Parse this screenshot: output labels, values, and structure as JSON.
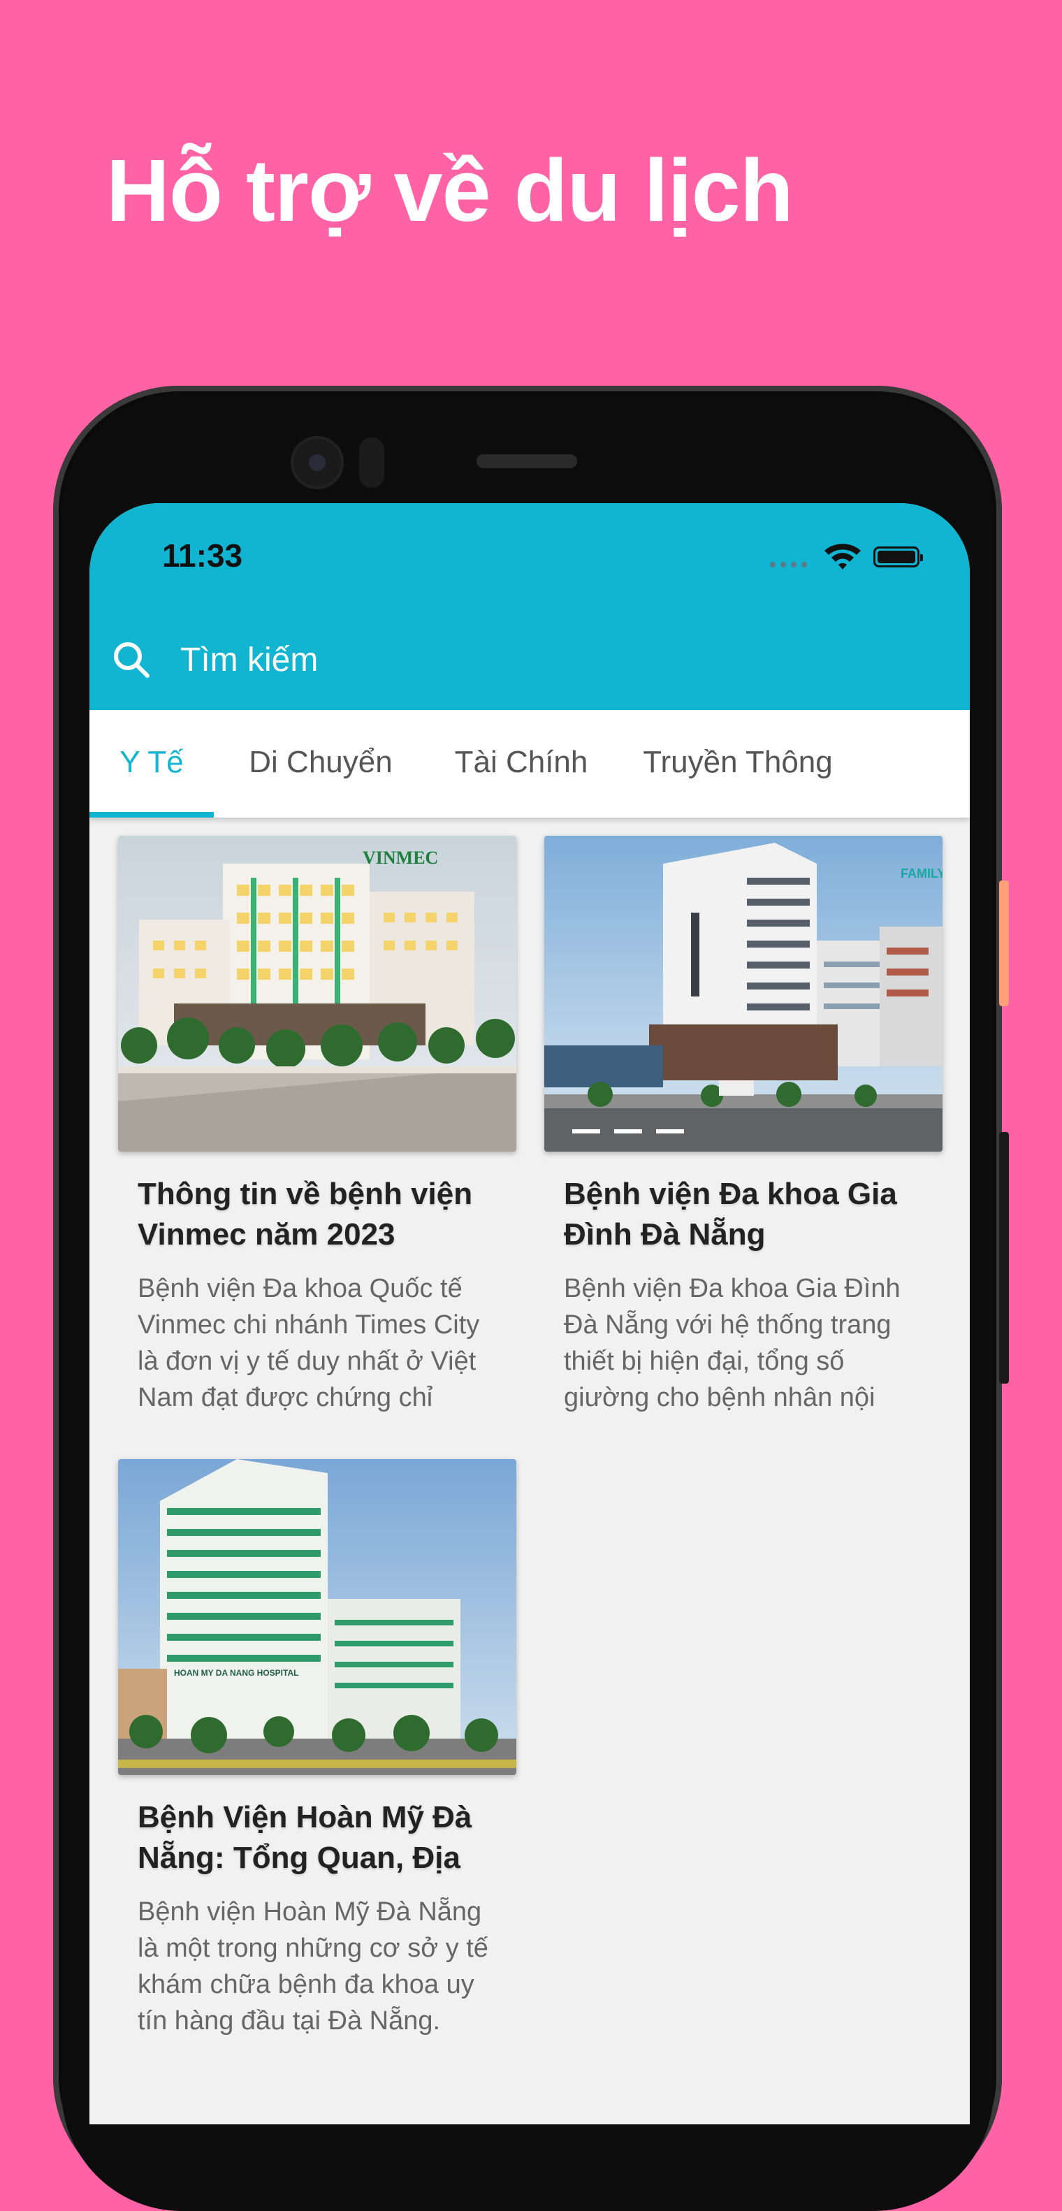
{
  "headline": "Hỗ trợ về du lịch",
  "status_bar": {
    "time": "11:33"
  },
  "search": {
    "placeholder": "Tìm kiếm"
  },
  "tabs": [
    {
      "label": "Y Tế",
      "active": true
    },
    {
      "label": "Di Chuyển",
      "active": false
    },
    {
      "label": "Tài Chính",
      "active": false
    },
    {
      "label": "Truyền Thông",
      "active": false
    }
  ],
  "cards": [
    {
      "title": "Thông tin về bệnh viện Vinmec năm 2023",
      "description": "Bệnh viện Đa khoa Quốc tế Vinmec chi nhánh Times City là đơn vị y tế duy nhất ở Việt Nam đạt được chứng chỉ JCI…",
      "image_text": "VINMEC"
    },
    {
      "title": "Bệnh viện Đa khoa Gia Đình Đà Nẵng",
      "description": "Bệnh viện Đa khoa Gia Đình Đà Nẵng với hệ thống trang thiết bị hiện đại, tổng số giường cho bệnh nhân nội tr…",
      "image_text": "FAMILY"
    },
    {
      "title": "Bệnh Viện Hoàn Mỹ Đà Nẵng: Tổng Quan, Địa C…",
      "description": "Bệnh viện Hoàn Mỹ Đà Nẵng là một trong những cơ sở y tế khám chữa bệnh đa khoa uy tín hàng đầu tại Đà Nẵng. Đâ…",
      "image_text": "HOAN MY DA NANG HOSPITAL"
    }
  ],
  "colors": {
    "background": "#FF63A5",
    "accent": "#11B5D2",
    "tab_inactive": "#555555"
  },
  "icons": [
    "search-icon",
    "wifi-icon",
    "battery-icon",
    "signal-dots-icon"
  ]
}
